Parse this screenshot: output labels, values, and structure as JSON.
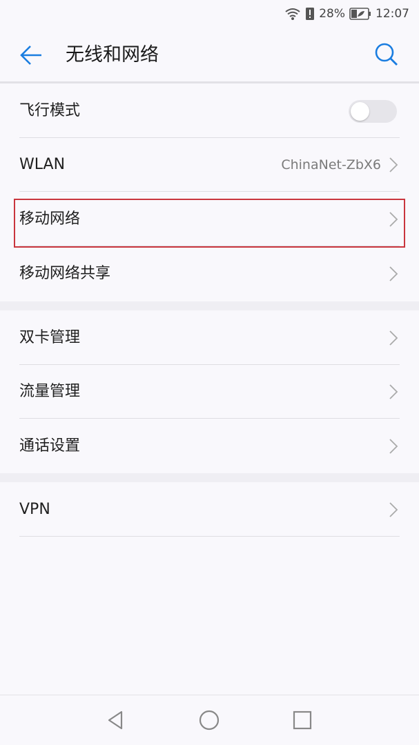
{
  "status": {
    "battery_percent": "28%",
    "time": "12:07"
  },
  "header": {
    "title": "无线和网络"
  },
  "rows": [
    {
      "label": "飞行模式",
      "type": "toggle",
      "toggle_on": false
    },
    {
      "label": "WLAN",
      "value": "ChinaNet-ZbX6",
      "type": "link"
    },
    {
      "label": "移动网络",
      "type": "link",
      "highlighted": true
    },
    {
      "label": "移动网络共享",
      "type": "link"
    },
    {
      "label": "双卡管理",
      "type": "link"
    },
    {
      "label": "流量管理",
      "type": "link"
    },
    {
      "label": "通话设置",
      "type": "link"
    },
    {
      "label": "VPN",
      "type": "link"
    }
  ],
  "colors": {
    "accent": "#1a7de0",
    "highlight_border": "#c9353d"
  },
  "icons": {
    "back": "arrow-left-icon",
    "search": "search-icon",
    "nav_back": "triangle-back-icon",
    "nav_home": "circle-home-icon",
    "nav_recent": "square-recent-icon"
  }
}
